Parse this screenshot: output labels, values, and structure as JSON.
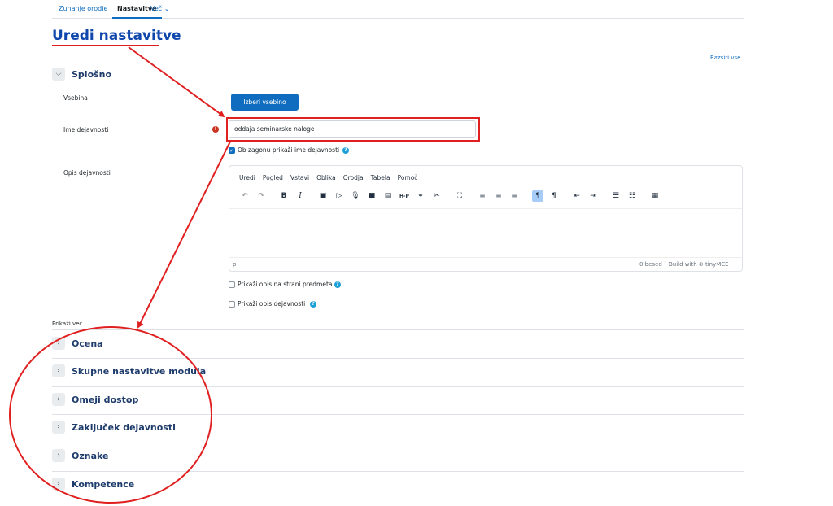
{
  "tabs": [
    {
      "label": "Zunanje orodje"
    },
    {
      "label": "Nastavitve"
    },
    {
      "label": "Več ⌄"
    }
  ],
  "page_title": "Uredi nastavitve",
  "expand_all": "Razširi vse",
  "general": {
    "title": "Splošno",
    "content_label": "Vsebina",
    "select_content_button": "Izberi vsebino",
    "activity_name_label": "Ime dejavnosti",
    "activity_name_value": "oddaja seminarske naloge",
    "show_name_label": "Ob zagonu prikaži ime dejavnosti",
    "description_label": "Opis dejavnosti",
    "show_on_course_label": "Prikaži opis na strani predmeta",
    "show_description_label": "Prikaži opis dejavnosti",
    "show_more": "Prikaži več..."
  },
  "editor": {
    "menu": [
      "Uredi",
      "Pogled",
      "Vstavi",
      "Oblika",
      "Orodja",
      "Tabela",
      "Pomoč"
    ],
    "status_path": "p",
    "word_count": "0 besed",
    "branding": "Build with ⊕ tinyMCE"
  },
  "sections": [
    {
      "title": "Ocena"
    },
    {
      "title": "Skupne nastavitve modula"
    },
    {
      "title": "Omeji dostop"
    },
    {
      "title": "Zaključek dejavnosti"
    },
    {
      "title": "Oznake"
    },
    {
      "title": "Kompetence"
    }
  ],
  "colors": {
    "accent": "#0f6cbf",
    "annotation": "#e02020",
    "title": "#0f47ad"
  }
}
